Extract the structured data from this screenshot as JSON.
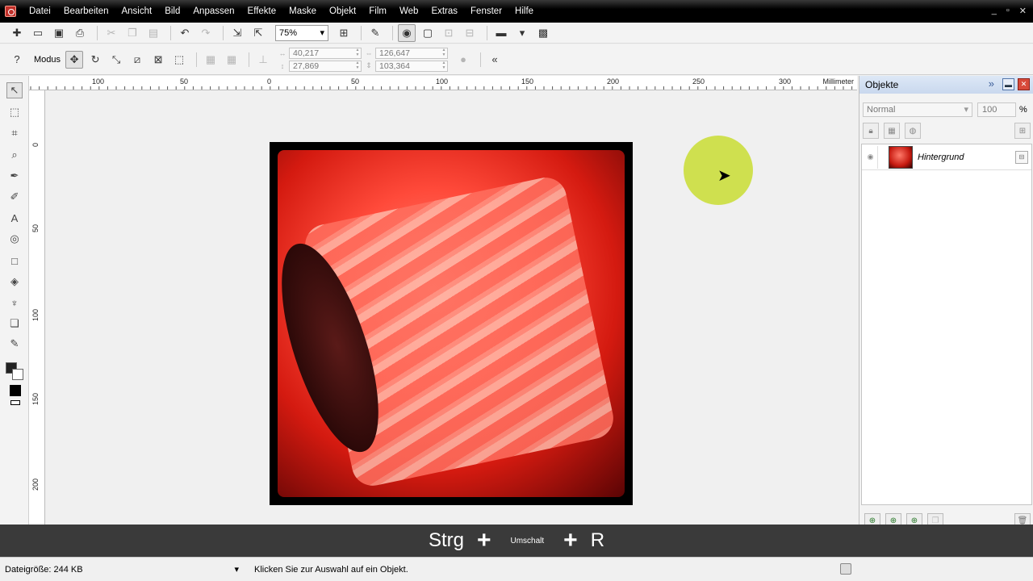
{
  "menu": [
    "Datei",
    "Bearbeiten",
    "Ansicht",
    "Bild",
    "Anpassen",
    "Effekte",
    "Maske",
    "Objekt",
    "Film",
    "Web",
    "Extras",
    "Fenster",
    "Hilfe"
  ],
  "window_controls": [
    "_",
    "▫",
    "✕"
  ],
  "toolbar": {
    "zoom_value": "75%",
    "mode_label": "Modus"
  },
  "transform": {
    "x": "40,217",
    "y": "27,869",
    "width": "126,647",
    "height": "103,364"
  },
  "ruler": {
    "top_labels": [
      "100",
      "50",
      "0",
      "50",
      "100",
      "150",
      "200",
      "250",
      "300"
    ],
    "left_labels": [
      "0",
      "50",
      "100",
      "150",
      "200"
    ],
    "unit": "Millimeter"
  },
  "panel": {
    "title": "Objekte",
    "blend_mode": "Normal",
    "opacity": "100",
    "opacity_unit": "%",
    "layers": [
      {
        "name": "Hintergrund"
      }
    ]
  },
  "shortcut": {
    "key1": "Strg",
    "key2": "Umschalt",
    "key3": "R",
    "plus": "+"
  },
  "status": {
    "file_size": "Dateigröße: 244 KB",
    "hint": "Klicken Sie zur Auswahl auf ein Objekt."
  },
  "colors": {
    "menubar": "#000000",
    "panel_header": "#c9d8ee",
    "cursor_halo": "#c9dd33",
    "photo_tone": "#ff4a3a"
  }
}
